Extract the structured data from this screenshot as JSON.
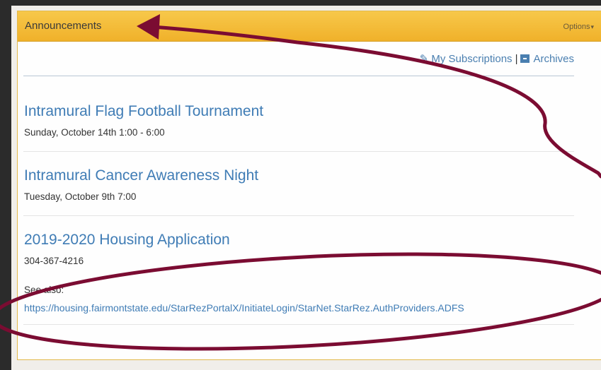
{
  "panel": {
    "title": "Announcements",
    "options_label": "Options",
    "caret": "▾"
  },
  "toolbar": {
    "subscriptions_label": "My Subscriptions",
    "separator": "|",
    "archives_label": "Archives"
  },
  "announcements": [
    {
      "title": "Intramural Flag Football Tournament",
      "detail": "Sunday, October 14th 1:00 - 6:00"
    },
    {
      "title": "Intramural Cancer Awareness Night",
      "detail": "Tuesday, October 9th 7:00"
    },
    {
      "title": "2019-2020 Housing Application",
      "detail": "304-367-4216",
      "see_also_label": "See also:",
      "link": "https://housing.fairmontstate.edu/StarRezPortalX/InitiateLogin/StarNet.StarRez.AuthProviders.ADFS"
    }
  ],
  "colors": {
    "header": "#f0b12a",
    "link": "#3f7cb5",
    "annotation": "#7b0c32"
  },
  "icons": [
    "pencil-square-icon",
    "archive-icon",
    "caret-down-icon"
  ]
}
